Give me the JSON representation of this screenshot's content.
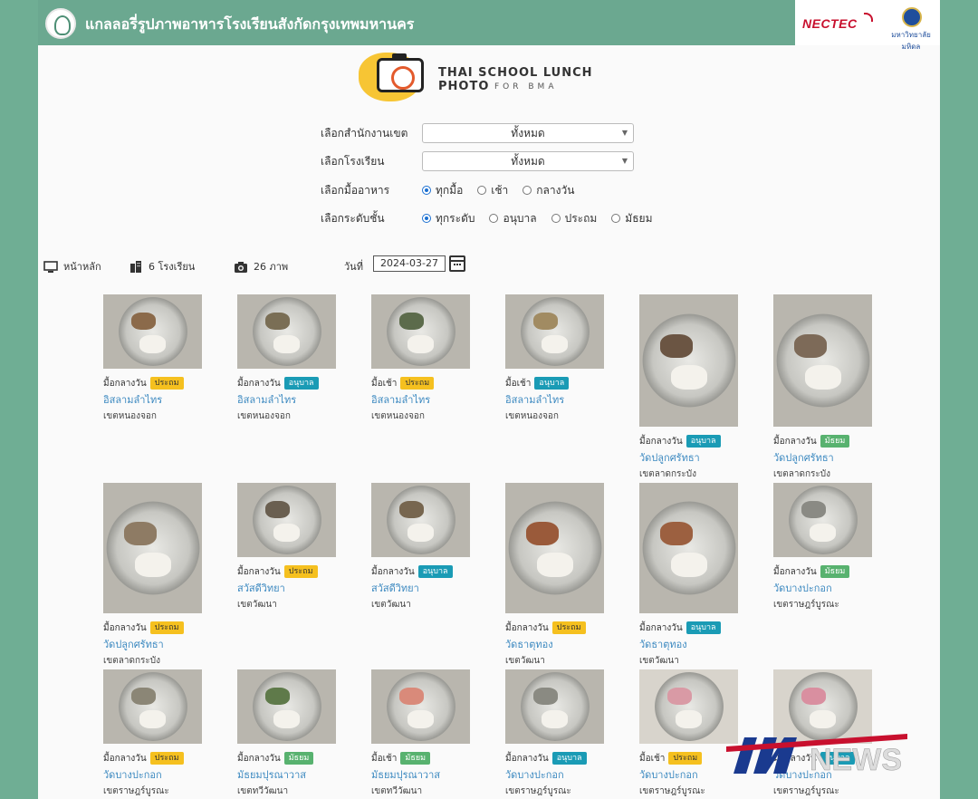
{
  "header": {
    "site_title": "แกลลอรี่รูปภาพอาหารโรงเรียนสังกัดกรุงเทพมหานคร",
    "partner1": "NECTEC",
    "partner2": "มหาวิทยาลัยมหิดล"
  },
  "brand": {
    "title": "THAI SCHOOL LUNCH PHOTO",
    "subtitle": "FOR BMA"
  },
  "filters": {
    "district_label": "เลือกสำนักงานเขต",
    "district_value": "ทั้งหมด",
    "school_label": "เลือกโรงเรียน",
    "school_value": "ทั้งหมด",
    "meal_label": "เลือกมื้ออาหาร",
    "meal_options": [
      "ทุกมื้อ",
      "เช้า",
      "กลางวัน"
    ],
    "level_label": "เลือกระดับชั้น",
    "level_options": [
      "ทุกระดับ",
      "อนุบาล",
      "ประถม",
      "มัธยม"
    ]
  },
  "stats": {
    "home": "หน้าหลัก",
    "schools": "6 โรงเรียน",
    "photos": "26 ภาพ",
    "date_label": "วันที่",
    "date_value": "2024-03-27"
  },
  "cards": [
    {
      "meal": "มื้อกลางวัน",
      "level": "ประถม",
      "level_color": "y",
      "school": "อิสลามลำไทร",
      "district": "เขตหนองจอก"
    },
    {
      "meal": "มื้อกลางวัน",
      "level": "อนุบาล",
      "level_color": "b",
      "school": "อิสลามลำไทร",
      "district": "เขตหนองจอก"
    },
    {
      "meal": "มื้อเช้า",
      "level": "ประถม",
      "level_color": "y",
      "school": "อิสลามลำไทร",
      "district": "เขตหนองจอก"
    },
    {
      "meal": "มื้อเช้า",
      "level": "อนุบาล",
      "level_color": "b",
      "school": "อิสลามลำไทร",
      "district": "เขตหนองจอก"
    },
    {
      "meal": "มื้อกลางวัน",
      "level": "อนุบาล",
      "level_color": "b",
      "school": "วัดปลูกศรัทธา",
      "district": "เขตลาดกระบัง"
    },
    {
      "meal": "มื้อกลางวัน",
      "level": "มัธยม",
      "level_color": "g",
      "school": "วัดปลูกศรัทธา",
      "district": "เขตลาดกระบัง"
    },
    {
      "meal": "มื้อกลางวัน",
      "level": "ประถม",
      "level_color": "y",
      "school": "วัดปลูกศรัทธา",
      "district": "เขตลาดกระบัง"
    },
    {
      "meal": "มื้อกลางวัน",
      "level": "ประถม",
      "level_color": "y",
      "school": "สวัสดีวิทยา",
      "district": "เขตวัฒนา"
    },
    {
      "meal": "มื้อกลางวัน",
      "level": "อนุบาล",
      "level_color": "b",
      "school": "สวัสดีวิทยา",
      "district": "เขตวัฒนา"
    },
    {
      "meal": "มื้อกลางวัน",
      "level": "ประถม",
      "level_color": "y",
      "school": "วัดธาตุทอง",
      "district": "เขตวัฒนา"
    },
    {
      "meal": "มื้อกลางวัน",
      "level": "อนุบาล",
      "level_color": "b",
      "school": "วัดธาตุทอง",
      "district": "เขตวัฒนา"
    },
    {
      "meal": "มื้อกลางวัน",
      "level": "มัธยม",
      "level_color": "g",
      "school": "วัดบางปะกอก",
      "district": "เขตราษฎร์บูรณะ"
    },
    {
      "meal": "มื้อกลางวัน",
      "level": "ประถม",
      "level_color": "y",
      "school": "วัดบางปะกอก",
      "district": "เขตราษฎร์บูรณะ"
    },
    {
      "meal": "มื้อกลางวัน",
      "level": "มัธยม",
      "level_color": "g",
      "school": "มัธยมปุรณาวาส",
      "district": "เขตทวีวัฒนา"
    },
    {
      "meal": "มื้อเช้า",
      "level": "มัธยม",
      "level_color": "g",
      "school": "มัธยมปุรณาวาส",
      "district": "เขตทวีวัฒนา"
    },
    {
      "meal": "มื้อกลางวัน",
      "level": "อนุบาล",
      "level_color": "b",
      "school": "วัดบางปะกอก",
      "district": "เขตราษฎร์บูรณะ"
    },
    {
      "meal": "มื้อเช้า",
      "level": "ประถม",
      "level_color": "y",
      "school": "วัดบางปะกอก",
      "district": "เขตราษฎร์บูรณะ"
    },
    {
      "meal": "มื้อกลางวัน",
      "level": "อนุบาล",
      "level_color": "b",
      "school": "วัดบางปะกอก",
      "district": "เขตราษฎร์บูรณะ"
    }
  ],
  "watermark": {
    "text": "NEWS"
  }
}
